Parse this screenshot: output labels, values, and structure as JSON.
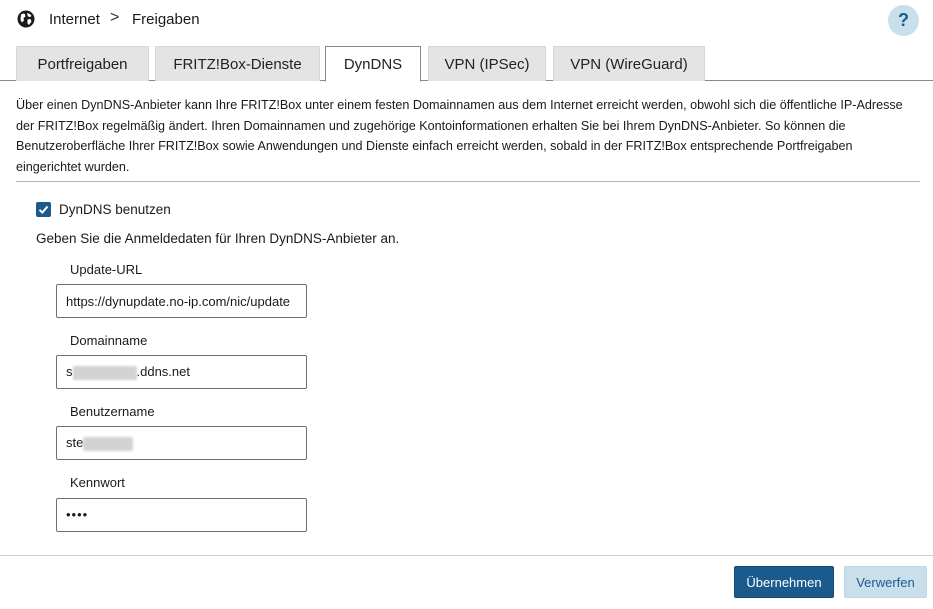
{
  "breadcrumb": {
    "section": "Internet",
    "separator": ">",
    "page": "Freigaben"
  },
  "help": {
    "label": "?"
  },
  "tabs": [
    {
      "label": "Portfreigaben",
      "active": false
    },
    {
      "label": "FRITZ!Box-Dienste",
      "active": false
    },
    {
      "label": "DynDNS",
      "active": true
    },
    {
      "label": "VPN (IPSec)",
      "active": false
    },
    {
      "label": "VPN (WireGuard)",
      "active": false
    }
  ],
  "description": "Über einen DynDNS-Anbieter kann Ihre FRITZ!Box unter einem festen Domainnamen aus dem Internet erreicht werden, obwohl sich die öffentliche IP-Adresse der FRITZ!Box regelmäßig ändert. Ihren Domainnamen und zugehörige Kontoinformationen erhalten Sie bei Ihrem DynDNS-Anbieter. So können die Benutzeroberfläche Ihrer FRITZ!Box sowie Anwendungen und Dienste einfach erreicht werden, sobald in der FRITZ!Box entsprechende Portfreigaben eingerichtet wurden.",
  "form": {
    "use_dyndns_label": "DynDNS benutzen",
    "use_dyndns_checked": true,
    "intro": "Geben Sie die Anmeldedaten für Ihren DynDNS-Anbieter an.",
    "update_url": {
      "label": "Update-URL",
      "value": "https://dynupdate.no-ip.com/nic/update"
    },
    "domain": {
      "label": "Domainname",
      "value_prefix": "s",
      "value_suffix": ".ddns.net"
    },
    "username": {
      "label": "Benutzername",
      "value_prefix": "ste"
    },
    "password": {
      "label": "Kennwort",
      "value": "••••"
    }
  },
  "buttons": {
    "apply": "Übernehmen",
    "discard": "Verwerfen"
  },
  "colors": {
    "accent": "#1b5a8c",
    "secondary_button": "#c9e0ec",
    "tab_inactive": "#e4e4e4"
  }
}
